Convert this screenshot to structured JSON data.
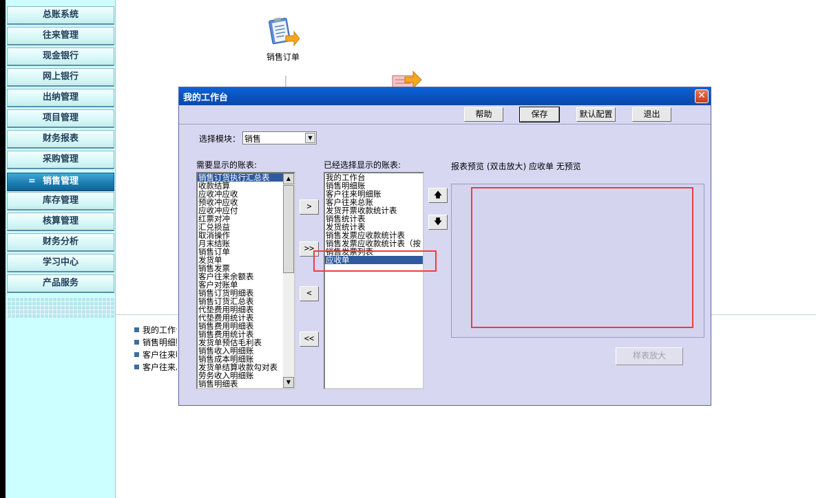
{
  "nav": {
    "items": [
      {
        "label": "总账系统",
        "active": false
      },
      {
        "label": "往来管理",
        "active": false
      },
      {
        "label": "现金银行",
        "active": false
      },
      {
        "label": "网上银行",
        "active": false
      },
      {
        "label": "出纳管理",
        "active": false
      },
      {
        "label": "项目管理",
        "active": false
      },
      {
        "label": "财务报表",
        "active": false
      },
      {
        "label": "采购管理",
        "active": false
      },
      {
        "label": "销售管理",
        "active": true
      },
      {
        "label": "库存管理",
        "active": false
      },
      {
        "label": "核算管理",
        "active": false
      },
      {
        "label": "财务分析",
        "active": false
      },
      {
        "label": "学习中心",
        "active": false
      },
      {
        "label": "产品服务",
        "active": false
      }
    ],
    "active_marker": "="
  },
  "desktop": {
    "sales_order_label": "销售订单",
    "bg_list": [
      "我的工作台",
      "销售明细账",
      "客户往来明细账",
      "客户往来总账"
    ]
  },
  "dialog": {
    "title": "我的工作台",
    "close_glyph": "✕",
    "toolbar": {
      "help": "帮助",
      "save": "保存",
      "default_config": "默认配置",
      "exit": "退出"
    },
    "module_label": "选择模块：",
    "module_value": "销售",
    "available_label": "需要显示的账表:",
    "selected_label": "已经选择显示的账表:",
    "preview_label": "报表预览 (双击放大)  应收单 无预览",
    "available_items": [
      "销售订货执行汇总表",
      "收款结算",
      "应收冲应收",
      "预收冲应收",
      "应收冲应付",
      "红票对冲",
      "汇兑损益",
      "取消操作",
      "月末结账",
      "销售订单",
      "发货单",
      "销售发票",
      "客户往来余额表",
      "客户对账单",
      "销售订货明细表",
      "销售订货汇总表",
      "代垫费用明细表",
      "代垫费用统计表",
      "销售费用明细表",
      "销售费用统计表",
      "发货单预估毛利表",
      "销售收入明细账",
      "销售成本明细账",
      "发货单结算收款勾对表",
      "劳务收入明细账",
      "销售明细表"
    ],
    "available_selected_index": 0,
    "selected_items": [
      "我的工作台",
      "销售明细账",
      "客户往来明细账",
      "客户往来总账",
      "发货开票收款统计表",
      "销售统计表",
      "发货统计表",
      "销售发票应收款统计表",
      "销售发票应收款统计表（按",
      "销售发票列表",
      "应收单"
    ],
    "selected_selected_index": 10,
    "move_buttons": {
      "add": ">",
      "add_all": ">>",
      "remove": "<",
      "remove_all": "<<"
    },
    "order_buttons": {
      "up": "🡅",
      "down": "🡇"
    },
    "zoom_button": "样表放大"
  }
}
